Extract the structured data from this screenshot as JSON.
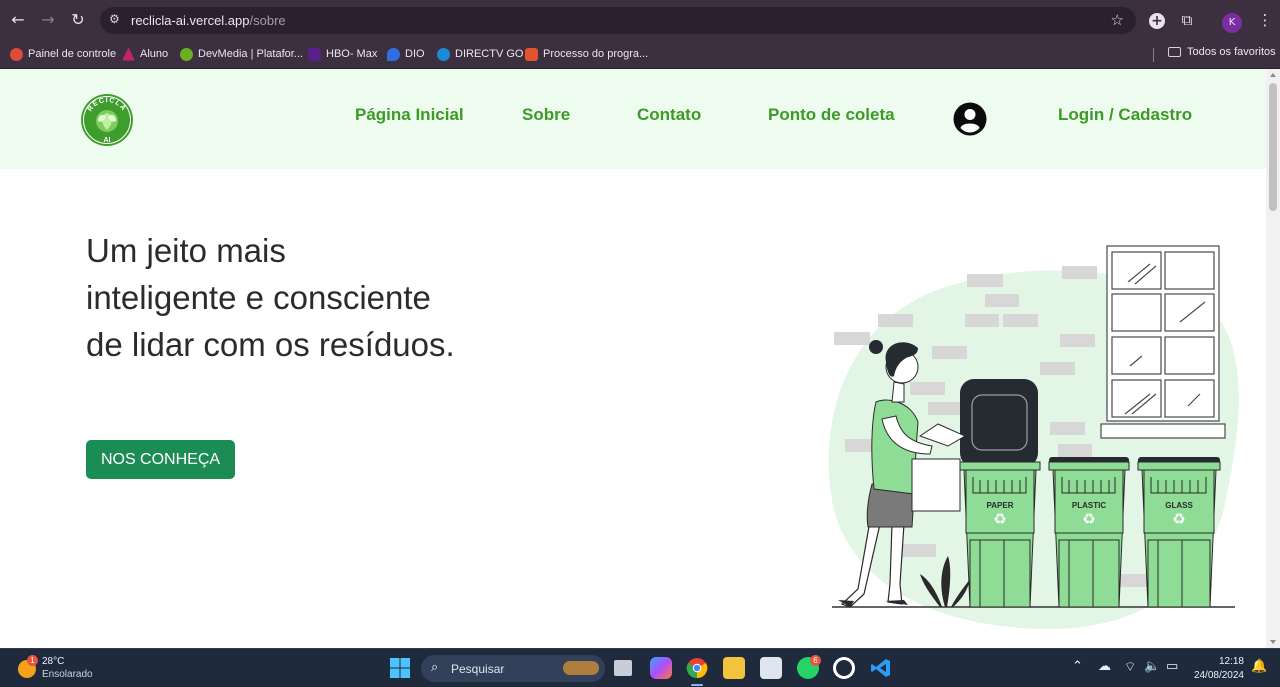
{
  "browser": {
    "url_host": "reclicla-ai.vercel.app",
    "url_path": "/sobre",
    "bookmarks": [
      {
        "label": "Painel de controle",
        "icon": "gear-red-icon",
        "color": "#e04a3a"
      },
      {
        "label": "Aluno",
        "icon": "aluno-logo-icon",
        "color": "#c0246a"
      },
      {
        "label": "DevMedia | Platafor...",
        "icon": "devmedia-icon",
        "color": "#6ab023"
      },
      {
        "label": "HBO- Max",
        "icon": "hbo-max-icon",
        "color": "#5b1f8a"
      },
      {
        "label": "DIO",
        "icon": "dio-icon",
        "color": "#2f6fe0"
      },
      {
        "label": "DIRECTV GO",
        "icon": "directv-icon",
        "color": "#1e8ad6"
      },
      {
        "label": "Processo do progra...",
        "icon": "folder-red-icon",
        "color": "#e2542f"
      }
    ],
    "all_bookmarks_label": "Todos os favoritos",
    "profile_initial": "K"
  },
  "site": {
    "logo_top_text": "RECICLA",
    "logo_bottom_text": "AI",
    "nav": [
      {
        "label": "Página Inicial"
      },
      {
        "label": "Sobre"
      },
      {
        "label": "Contato"
      },
      {
        "label": "Ponto de coleta"
      }
    ],
    "login_label": "Login / Cadastro",
    "hero_lines": [
      "Um jeito mais",
      "inteligente e consciente",
      "de lidar com os resíduos."
    ],
    "cta_label": "NOS CONHEÇA",
    "bins": [
      "PAPER",
      "PLASTIC",
      "GLASS"
    ],
    "colors": {
      "header_bg": "#eefcef",
      "nav_green": "#3d9a26",
      "cta_green": "#1c8c55",
      "bin_green": "#8fdc96"
    }
  },
  "taskbar": {
    "temperature": "28°C",
    "condition": "Ensolarado",
    "weather_badge": "1",
    "search_placeholder": "Pesquisar",
    "whatsapp_badge": "6",
    "time": "12:18",
    "date": "24/08/2024"
  }
}
